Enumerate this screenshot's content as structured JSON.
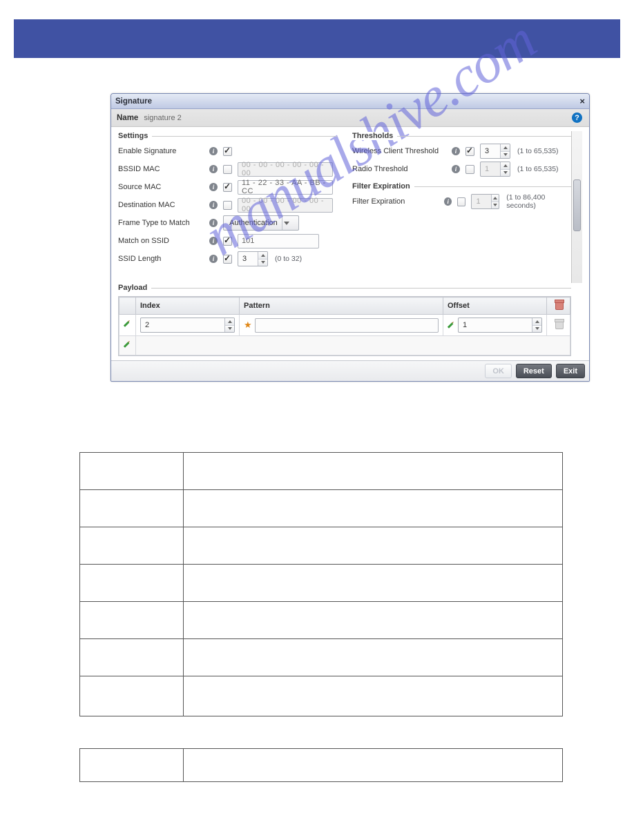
{
  "dialog": {
    "title": "Signature",
    "name_label": "Name",
    "name_value": "signature 2",
    "close_symbol": "×",
    "help_symbol": "?"
  },
  "settings": {
    "group_title": "Settings",
    "enable_signature_label": "Enable Signature",
    "enable_signature_checked": true,
    "bssid_mac_label": "BSSID MAC",
    "bssid_mac_checked": false,
    "bssid_mac_value": "00 - 00 - 00 - 00 - 00 - 00",
    "source_mac_label": "Source MAC",
    "source_mac_checked": true,
    "source_mac_value": "11 - 22 - 33 - AA - BB - CC",
    "dest_mac_label": "Destination MAC",
    "dest_mac_checked": false,
    "dest_mac_value": "00 - 00 - 00 - 00 - 00 - 00",
    "frame_type_label": "Frame Type to Match",
    "frame_type_value": "Authentication",
    "match_ssid_label": "Match on SSID",
    "match_ssid_checked": true,
    "match_ssid_value": "101",
    "ssid_length_label": "SSID Length",
    "ssid_length_checked": true,
    "ssid_length_value": "3",
    "ssid_length_range": "(0 to 32)"
  },
  "thresholds": {
    "group_title": "Thresholds",
    "wireless_client_label": "Wireless Client Threshold",
    "wireless_client_checked": true,
    "wireless_client_value": "3",
    "wireless_client_range": "(1 to 65,535)",
    "radio_label": "Radio Threshold",
    "radio_checked": false,
    "radio_value": "1",
    "radio_range": "(1 to 65,535)"
  },
  "filter_expiration": {
    "group_title": "Filter Expiration",
    "label": "Filter Expiration",
    "checked": false,
    "value": "1",
    "range": "(1 to 86,400 seconds)"
  },
  "payload": {
    "group_title": "Payload",
    "headers": {
      "index": "Index",
      "pattern": "Pattern",
      "offset": "Offset"
    },
    "row": {
      "index_value": "2",
      "pattern_value": "",
      "offset_value": "1"
    }
  },
  "footer": {
    "ok": "OK",
    "reset": "Reset",
    "exit": "Exit"
  },
  "watermark": "manualshive.com"
}
